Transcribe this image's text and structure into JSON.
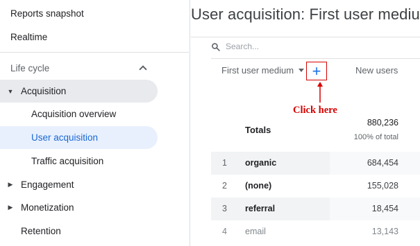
{
  "sidebar": {
    "top_items": [
      {
        "label": "Reports snapshot"
      },
      {
        "label": "Realtime"
      }
    ],
    "section": {
      "label": "Life cycle"
    },
    "acquisition": {
      "label": "Acquisition"
    },
    "acquisition_items": [
      {
        "label": "Acquisition overview"
      },
      {
        "label": "User acquisition"
      },
      {
        "label": "Traffic acquisition"
      }
    ],
    "groups": [
      {
        "label": "Engagement"
      },
      {
        "label": "Monetization"
      }
    ],
    "retention": {
      "label": "Retention"
    }
  },
  "main": {
    "title": "User acquisition: First user medium",
    "search_placeholder": "Search...",
    "columns": {
      "dimension": "First user medium",
      "add": "+",
      "metric": "New users"
    },
    "annotation": "Click here",
    "totals": {
      "label": "Totals",
      "value": "880,236",
      "percent": "100% of total"
    },
    "rows": [
      {
        "index": "1",
        "dimension": "organic",
        "value": "684,454"
      },
      {
        "index": "2",
        "dimension": "(none)",
        "value": "155,028"
      },
      {
        "index": "3",
        "dimension": "referral",
        "value": "18,454"
      },
      {
        "index": "4",
        "dimension": "email",
        "value": "13,143"
      }
    ]
  },
  "colors": {
    "accent": "#1a73e8",
    "selected_bg": "#e8f0fe",
    "annotation": "#d50000"
  }
}
